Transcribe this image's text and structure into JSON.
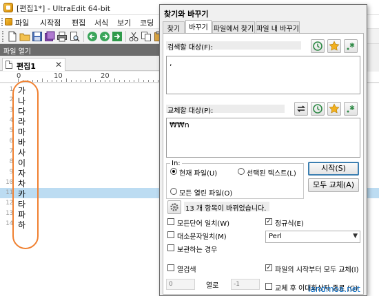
{
  "window": {
    "title": "[편집1*] - UltraEdit 64-bit"
  },
  "menu": {
    "items": [
      "파일",
      "시작점",
      "편집",
      "서식",
      "보기",
      "코딩"
    ]
  },
  "file_panel": {
    "title": "파일 열기"
  },
  "document_tab": {
    "label": "편집1",
    "close": "✕"
  },
  "ruler": {
    "marks": [
      "0",
      "10",
      "20"
    ]
  },
  "editor": {
    "current_line": 11,
    "lines": [
      {
        "n": "1",
        "text": "가"
      },
      {
        "n": "2",
        "text": "나"
      },
      {
        "n": "3",
        "text": "다"
      },
      {
        "n": "4",
        "text": "라"
      },
      {
        "n": "5",
        "text": "마"
      },
      {
        "n": "6",
        "text": "바"
      },
      {
        "n": "7",
        "text": "사"
      },
      {
        "n": "8",
        "text": "이"
      },
      {
        "n": "9",
        "text": "자"
      },
      {
        "n": "10",
        "text": "차"
      },
      {
        "n": "11",
        "text": "카"
      },
      {
        "n": "12",
        "text": "타"
      },
      {
        "n": "13",
        "text": "파"
      },
      {
        "n": "14",
        "text": "하"
      }
    ]
  },
  "dialog": {
    "title": "찾기와 바꾸기",
    "tabs": [
      "찾기",
      "바꾸기",
      "파일에서 찾기",
      "파일 내 바꾸기"
    ],
    "active_tab": 1,
    "find_label": "검색할 대상(F):",
    "find_value": ",",
    "replace_label": "교체할 대상(P):",
    "replace_value": "₩₩n",
    "in_label": "In:",
    "scope_current": "현재 파일(U)",
    "scope_selected": "선택된 텍스트(L)",
    "scope_all_open": "모든 열린 파일(O)",
    "start_button": "시작(S)",
    "replace_all_button": "모두 교체(A)",
    "status_text": "13 개 항목이 바뀌었습니다.",
    "opt_match_word": "모든단어 일치(W)",
    "opt_match_case": "대소문자일치(M)",
    "opt_preserve_case": "보관하는 경우",
    "opt_regex": "정규식(E)",
    "regex_engine": "Perl",
    "opt_column": "열검색",
    "opt_replace_from_top": "파일의 시작부터 모두 교체(I)",
    "opt_close_after": "교체 후 이대화상자 종료 (G)",
    "column_from": "0",
    "column_label": "열로",
    "column_to": "-1",
    "regex_checked": true,
    "replace_from_top_checked": true
  },
  "watermark": "landmoa.net",
  "colors": {
    "highlight_line": "#bcdcf2",
    "annotation_oval": "#f08030",
    "watermark": "#0a6ec7"
  }
}
